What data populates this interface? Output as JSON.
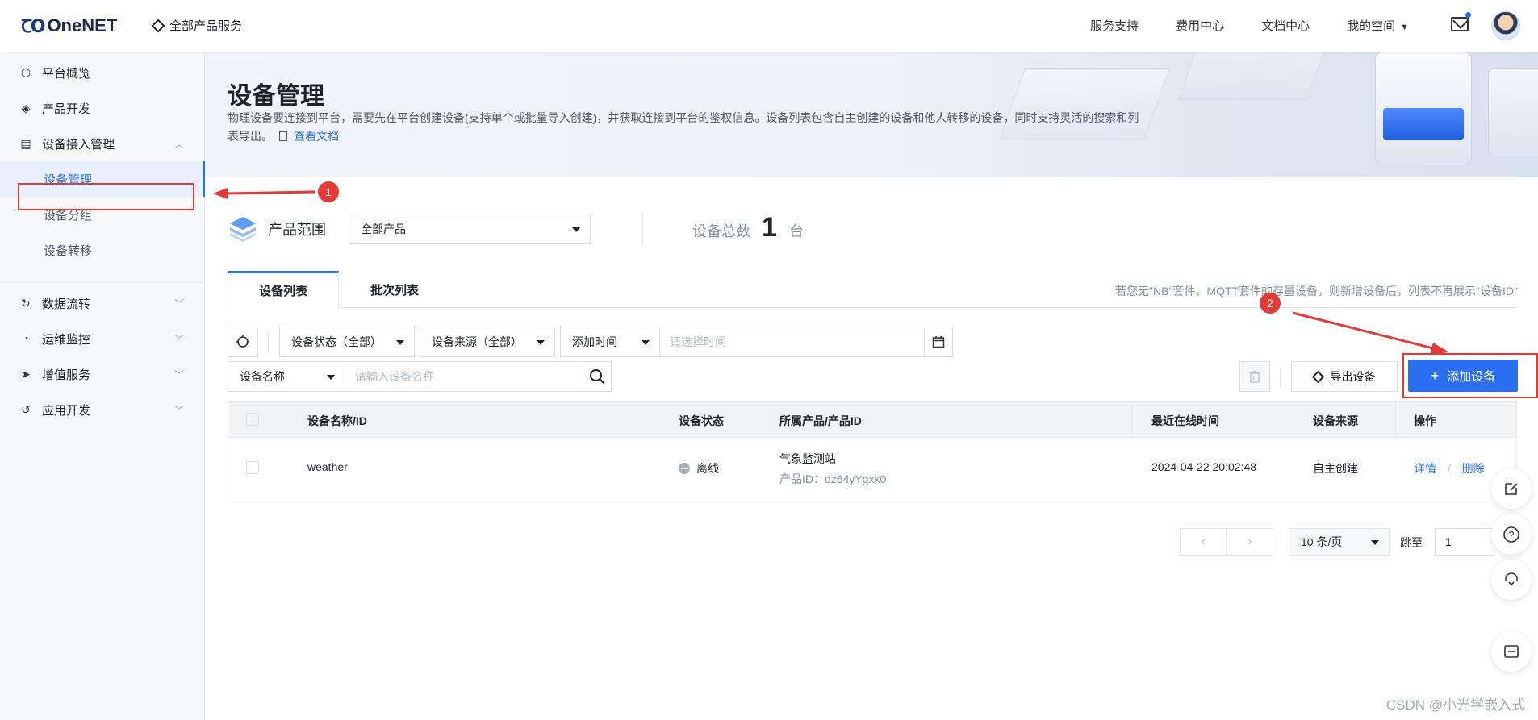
{
  "header": {
    "logo_mark": "ꞆO",
    "logo_text": "OneNET",
    "all_products": "全部产品服务",
    "nav": [
      "服务支持",
      "费用中心",
      "文档中心",
      "我的空间"
    ]
  },
  "sidebar": {
    "items": [
      {
        "label": "平台概览",
        "icon": "hexagon-icon",
        "glyph": "⬡"
      },
      {
        "label": "产品开发",
        "icon": "cube-icon",
        "glyph": "◈"
      },
      {
        "label": "设备接入管理",
        "icon": "device-icon",
        "glyph": "▤"
      }
    ],
    "sub_items": [
      "设备管理",
      "设备分组",
      "设备转移"
    ],
    "more_items": [
      {
        "label": "数据流转",
        "icon": "flow-icon",
        "glyph": "↻"
      },
      {
        "label": "运维监控",
        "icon": "monitor-icon",
        "glyph": "◔"
      },
      {
        "label": "增值服务",
        "icon": "plane-icon",
        "glyph": "➤"
      },
      {
        "label": "应用开发",
        "icon": "app-icon",
        "glyph": "↺"
      }
    ]
  },
  "banner": {
    "title": "设备管理",
    "description": "物理设备要连接到平台，需要先在平台创建设备(支持单个或批量导入创建)，并获取连接到平台的鉴权信息。设备列表包含自主创建的设备和他人转移的设备，同时支持灵活的搜索和列表导出。",
    "doc_link": "查看文档"
  },
  "annotations": {
    "num1": "1",
    "num2": "2"
  },
  "filters": {
    "range_label": "产品范围",
    "product_select": "全部产品",
    "total_label": "设备总数",
    "total_count": "1",
    "total_unit": "台"
  },
  "tabs": [
    "设备列表",
    "批次列表"
  ],
  "tab_hint": "若您无\"NB\"套件、MQTT套件的存量设备，则新增设备后，列表不再展示\"设备ID\"",
  "toolbar": {
    "status_select": "设备状态（全部）",
    "source_select": "设备来源（全部）",
    "time_select": "添加时间",
    "time_placeholder": "请选择时间",
    "name_select": "设备名称",
    "name_placeholder": "请输入设备名称",
    "export_label": "导出设备",
    "add_label": "添加设备"
  },
  "table": {
    "columns": [
      "设备名称/ID",
      "设备状态",
      "所属产品/产品ID",
      "最近在线时间",
      "设备来源",
      "操作"
    ],
    "rows": [
      {
        "name": "weather",
        "status": "离线",
        "product": "气象监测站",
        "product_id": "产品ID：dz64yYgxk0",
        "last_online": "2024-04-22 20:02:48",
        "source": "自主创建",
        "action_detail": "详情",
        "action_sep": "/",
        "action_delete": "删除"
      }
    ]
  },
  "pagination": {
    "page_size": "10 条/页",
    "jump_label": "跳至",
    "jump_value": "1"
  },
  "watermark": "CSDN @小光学嵌入式"
}
